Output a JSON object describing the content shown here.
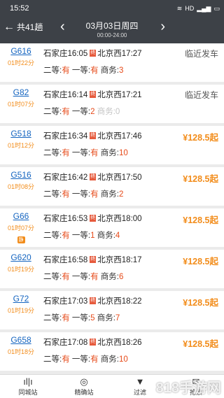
{
  "status": {
    "time": "15:52",
    "icons": "HD"
  },
  "nav": {
    "back_label": "共41趟",
    "date": "03月03日周四",
    "time_range": "00:00-24:00"
  },
  "trains": [
    {
      "no": "G616",
      "duration": "01时22分",
      "dep": "石家庄16:05",
      "arr": "北京西17:27",
      "tag": "终",
      "right": "临近发车",
      "second": "有",
      "first": "有",
      "business": "3",
      "kind": "status"
    },
    {
      "no": "G82",
      "duration": "01时07分",
      "dep": "石家庄16:14",
      "arr": "北京西17:21",
      "tag": "终",
      "right": "临近发车",
      "second": "有",
      "first": "2",
      "business": "0",
      "kind": "status"
    },
    {
      "no": "G518",
      "duration": "01时12分",
      "dep": "石家庄16:34",
      "arr": "北京西17:46",
      "tag": "终",
      "right": "¥128.5起",
      "second": "有",
      "first": "有",
      "business": "10",
      "kind": "price"
    },
    {
      "no": "G516",
      "duration": "01时08分",
      "dep": "石家庄16:42",
      "arr": "北京西17:50",
      "tag": "终",
      "right": "¥128.5起",
      "second": "有",
      "first": "有",
      "business": "2",
      "kind": "price"
    },
    {
      "no": "G66",
      "duration": "01时07分",
      "dep": "石家庄16:53",
      "arr": "北京西18:00",
      "tag": "终",
      "badge": "静",
      "right": "¥128.5起",
      "second": "有",
      "first": "1",
      "business": "4",
      "kind": "price"
    },
    {
      "no": "G620",
      "duration": "01时19分",
      "dep": "石家庄16:58",
      "arr": "北京西18:17",
      "tag": "终",
      "right": "¥128.5起",
      "second": "有",
      "first": "有",
      "business": "6",
      "kind": "price"
    },
    {
      "no": "G72",
      "duration": "01时19分",
      "dep": "石家庄17:03",
      "arr": "北京西18:22",
      "tag": "终",
      "right": "¥128.5起",
      "second": "有",
      "first": "5",
      "business": "7",
      "kind": "price"
    },
    {
      "no": "G658",
      "duration": "01时18分",
      "dep": "石家庄17:08",
      "arr": "北京西18:26",
      "tag": "终",
      "right": "¥128.5起",
      "second": "有",
      "first": "有",
      "business": "10",
      "kind": "price"
    }
  ],
  "labels": {
    "second": "二等:",
    "first": "一等:",
    "business": "商务:"
  },
  "tabs": [
    {
      "label": "同城站",
      "icon": "ıl|ı"
    },
    {
      "label": "精确站",
      "icon": "◎"
    },
    {
      "label": "过滤",
      "icon": "▼"
    },
    {
      "label": "抢票",
      "icon": "✉"
    }
  ],
  "watermark": "818手游网"
}
